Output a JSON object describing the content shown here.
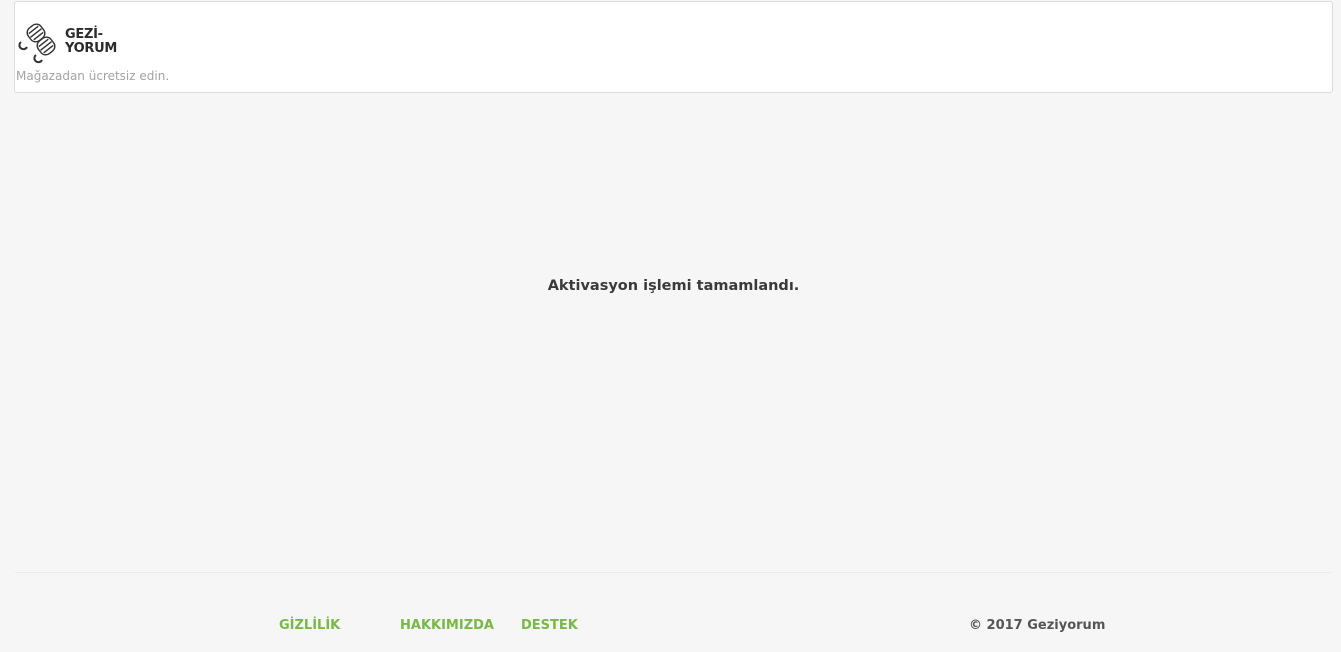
{
  "header": {
    "logo_text_line1": "GEZİ-",
    "logo_text_line2": "YORUM",
    "tagline": "Mağazadan ücretsiz edin."
  },
  "main": {
    "message": "Aktivasyon işlemi tamamlandı."
  },
  "footer": {
    "links": [
      {
        "label": "GİZLİLİK"
      },
      {
        "label": "HAKKIMIZDA"
      },
      {
        "label": "DESTEK"
      }
    ],
    "copyright": "© 2017 Geziyorum",
    "link_color": "#78b846"
  }
}
